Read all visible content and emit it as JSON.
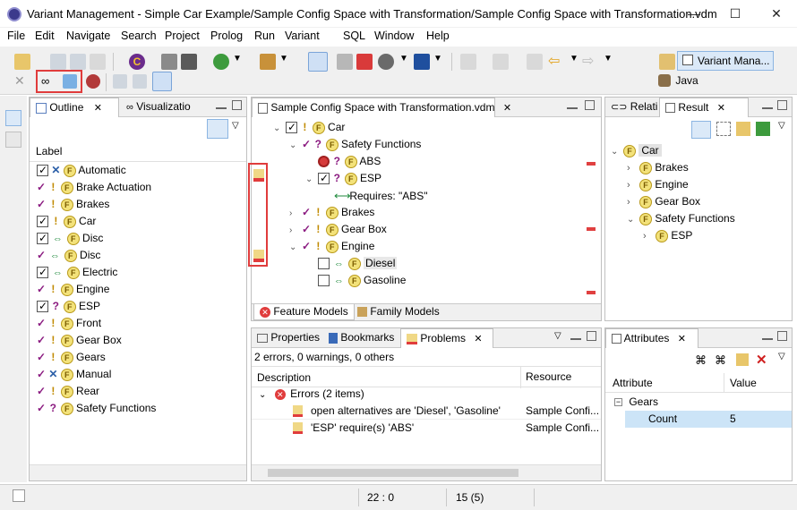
{
  "window": {
    "title": "Variant Management - Simple Car Example/Sample Config Space with Transformation/Sample Config Space with Transformation.vdm",
    "minimize": "—",
    "maximize": "☐",
    "close": "✕"
  },
  "menu": [
    "File",
    "Edit",
    "Navigate",
    "Search",
    "Project",
    "Prolog",
    "Run",
    "Variant",
    "SQL",
    "Window",
    "Help"
  ],
  "perspectives": {
    "variant": "Variant Mana...",
    "java": "Java"
  },
  "outline": {
    "tabs": [
      "Outline",
      "Visualizatio"
    ],
    "column": "Label",
    "items": [
      {
        "mark": "chk",
        "sel": "x",
        "label": "Automatic"
      },
      {
        "mark": "tick",
        "sel": "!",
        "label": "Brake Actuation"
      },
      {
        "mark": "tick",
        "sel": "!",
        "label": "Brakes"
      },
      {
        "mark": "chk",
        "sel": "!",
        "label": "Car"
      },
      {
        "mark": "chk",
        "sel": "arr",
        "label": "Disc"
      },
      {
        "mark": "tick",
        "sel": "arr",
        "label": "Disc"
      },
      {
        "mark": "chk",
        "sel": "arr",
        "label": "Electric"
      },
      {
        "mark": "tick",
        "sel": "!",
        "label": "Engine"
      },
      {
        "mark": "chk",
        "sel": "?",
        "label": "ESP"
      },
      {
        "mark": "tick",
        "sel": "!",
        "label": "Front"
      },
      {
        "mark": "tick",
        "sel": "!",
        "label": "Gear Box"
      },
      {
        "mark": "tick",
        "sel": "!",
        "label": "Gears"
      },
      {
        "mark": "tick",
        "sel": "x",
        "label": "Manual"
      },
      {
        "mark": "tick",
        "sel": "!",
        "label": "Rear"
      },
      {
        "mark": "tick",
        "sel": "?",
        "label": "Safety Functions"
      }
    ]
  },
  "editor": {
    "tab": "Sample Config Space with Transformation.vdm",
    "tree": [
      {
        "indent": 0,
        "exp": "v",
        "mark": "chk",
        "sel": "!",
        "label": "Car"
      },
      {
        "indent": 1,
        "exp": "v",
        "mark": "tick",
        "sel": "?",
        "label": "Safety Functions"
      },
      {
        "indent": 2,
        "exp": "",
        "mark": "stop",
        "sel": "?",
        "label": "ABS"
      },
      {
        "indent": 2,
        "exp": "v",
        "mark": "chk",
        "sel": "?",
        "label": "ESP"
      },
      {
        "indent": 3,
        "exp": "",
        "mark": "req",
        "sel": "",
        "label": "Requires: \"ABS\""
      },
      {
        "indent": 1,
        "exp": ">",
        "mark": "tick",
        "sel": "!",
        "label": "Brakes"
      },
      {
        "indent": 1,
        "exp": ">",
        "mark": "tick",
        "sel": "!",
        "label": "Gear Box"
      },
      {
        "indent": 1,
        "exp": "v",
        "mark": "tick",
        "sel": "!",
        "label": "Engine"
      },
      {
        "indent": 2,
        "exp": "",
        "mark": "box",
        "sel": "arr",
        "label": "Diesel"
      },
      {
        "indent": 2,
        "exp": "",
        "mark": "box",
        "sel": "arr",
        "label": "Gasoline"
      }
    ],
    "bottom_tabs": [
      "Feature Models",
      "Family Models"
    ]
  },
  "result": {
    "tabs": [
      "Relati",
      "Result"
    ],
    "tree": [
      {
        "indent": 0,
        "exp": "v",
        "label": "Car"
      },
      {
        "indent": 1,
        "exp": ">",
        "label": "Brakes"
      },
      {
        "indent": 1,
        "exp": ">",
        "label": "Engine"
      },
      {
        "indent": 1,
        "exp": ">",
        "label": "Gear Box"
      },
      {
        "indent": 1,
        "exp": "v",
        "label": "Safety Functions"
      },
      {
        "indent": 2,
        "exp": ">",
        "label": "ESP"
      }
    ]
  },
  "problems": {
    "tabs": [
      "Properties",
      "Bookmarks",
      "Problems"
    ],
    "summary": "2 errors, 0 warnings, 0 others",
    "col_description": "Description",
    "col_resource": "Resource",
    "group": "Errors (2 items)",
    "rows": [
      {
        "desc": "open alternatives are 'Diesel', 'Gasoline'",
        "res": "Sample Confi..."
      },
      {
        "desc": "'ESP' require(s) 'ABS'",
        "res": "Sample Confi..."
      }
    ]
  },
  "attributes": {
    "tab": "Attributes",
    "col_attr": "Attribute",
    "col_value": "Value",
    "group": "Gears",
    "row": {
      "name": "Count",
      "value": "5"
    }
  },
  "status": {
    "position": "22 : 0",
    "count": "15 (5)"
  }
}
